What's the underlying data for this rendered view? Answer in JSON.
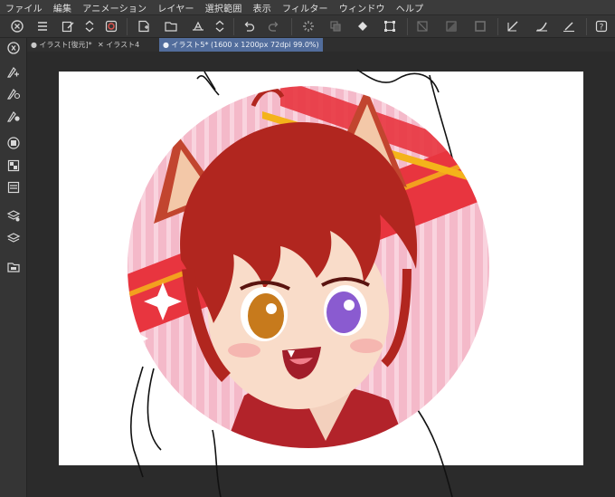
{
  "menu": [
    "ファイル",
    "編集",
    "アニメーション",
    "レイヤー",
    "選択範囲",
    "表示",
    "フィルター",
    "ウィンドウ",
    "ヘルプ"
  ],
  "tabs": [
    {
      "label": "● イラスト[復元]*"
    },
    {
      "label": "✕ イラスト4"
    },
    {
      "label": "● イラスト5* (1600 x 1200px 72dpi 99.0%)"
    }
  ],
  "toolbar_icons": [
    "menu-icon",
    "new-canvas-icon",
    "spinner-icon",
    "settings-icon",
    "new-layer-icon",
    "open-icon",
    "save-icon",
    "spinner-icon",
    "undo-icon",
    "redo-icon",
    "loading-icon",
    "copy-icon",
    "fill-icon",
    "transform-icon",
    "clear-selection-icon",
    "invert-selection-icon",
    "selection-border-icon",
    "pen-icon",
    "brush-icon",
    "draw-icon",
    "help-icon"
  ],
  "tool_icons": [
    "zoom-icon",
    "pen-tool-icon",
    "pencil-tool-icon",
    "fill-tool-icon",
    "layer-icon",
    "palette-icon",
    "panel-icon",
    "layers-stack-icon",
    "material-icon",
    "folder-icon"
  ],
  "colors": {
    "ui_dark": "#2b2b2b",
    "ui_panel": "#353535",
    "active_tab": "#526d9c",
    "canvas": "#ffffff",
    "hair": "#b1261f",
    "background_pink": "#f3b0c3",
    "stripe_red": "#e8353f",
    "stripe_yellow": "#f4b31a",
    "eye_left": "#c77a1c",
    "eye_right": "#8a5bd0"
  }
}
